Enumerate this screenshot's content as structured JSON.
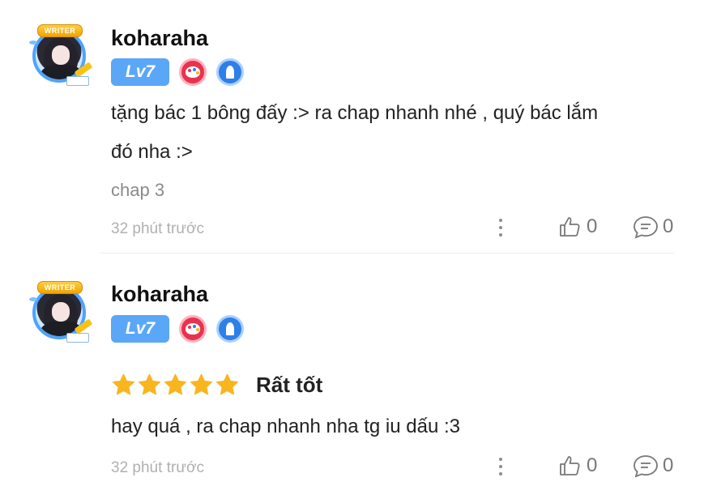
{
  "comments": [
    {
      "username": "koharaha",
      "level": "Lv7",
      "avatar_tag": "WRITER",
      "text_lines": [
        "tặng bác 1 bông đấy :> ra chap nhanh nhé , quý bác lắm",
        "đó nha :>"
      ],
      "chapter": "chap 3",
      "time": "32 phút trước",
      "likes": "0",
      "replies": "0"
    },
    {
      "username": "koharaha",
      "level": "Lv7",
      "avatar_tag": "WRITER",
      "rating": 5,
      "rating_label": "Rất tốt",
      "text_lines": [
        "hay quá , ra chap nhanh nha tg iu dấu :3"
      ],
      "time": "32 phút trước",
      "likes": "0",
      "replies": "0"
    }
  ],
  "colors": {
    "level_badge": "#5aa7f7",
    "star": "#f9b51e",
    "meta_text": "#b0b0b0"
  },
  "icons": [
    "writer-badge-icon",
    "palette-badge-icon",
    "pen-nib-badge-icon",
    "more-icon",
    "thumbs-up-icon",
    "comment-bubble-icon",
    "star-icon"
  ]
}
